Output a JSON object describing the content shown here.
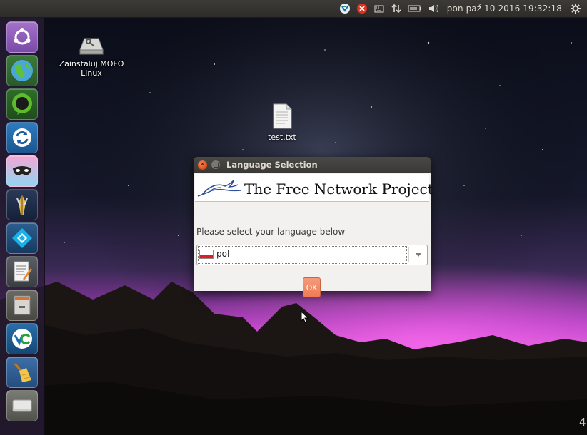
{
  "top_panel": {
    "clock": "pon paź 10 2016 19:32:18",
    "tray_icons": [
      "vbox-extension-icon",
      "error-icon",
      "keyboard-icon",
      "network-arrows-icon",
      "battery-icon",
      "volume-icon",
      "settings-gear-icon"
    ]
  },
  "launcher": {
    "items": [
      "ubuntu-dash",
      "web-browser",
      "messenger",
      "sync-app",
      "masked-app",
      "tor-like-app",
      "kodi",
      "text-editor",
      "file-manager",
      "veracrypt",
      "cleaner",
      "drive"
    ]
  },
  "desktop": {
    "icons": [
      {
        "label": "Zainstaluj MOFO Linux",
        "line1": "Zainstaluj MOFO",
        "line2": "Linux"
      },
      {
        "label": "test.txt"
      }
    ]
  },
  "dialog": {
    "title": "Language Selection",
    "banner": "The Free Network Project",
    "prompt": "Please select your language below",
    "selected_language": "pol",
    "ok_label": "OK"
  },
  "corner_text": "4",
  "colors": {
    "accent": "#e95420",
    "ok_button": "#ef7c54",
    "aurora": "#c24ad0"
  }
}
